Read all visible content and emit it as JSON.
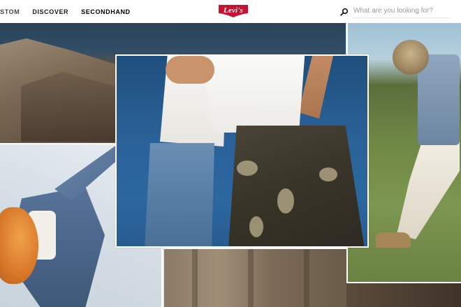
{
  "header": {
    "nav": [
      {
        "label": "USTOM",
        "active": false
      },
      {
        "label": "DISCOVER",
        "active": false
      },
      {
        "label": "SECONDHAND",
        "active": true
      }
    ],
    "logo": {
      "text": "Levi's",
      "color": "#c41230"
    },
    "search": {
      "placeholder": "What are you looking for?",
      "icon": "search-icon"
    }
  },
  "hero": {
    "tiles": [
      "cliff-tile",
      "grass-tile",
      "sky-tile",
      "rock-tile",
      "featured-jeans-tile"
    ]
  },
  "colors": {
    "brand": "#c41230",
    "text": "#1a1a1a",
    "placeholder": "#9a9a9a"
  }
}
